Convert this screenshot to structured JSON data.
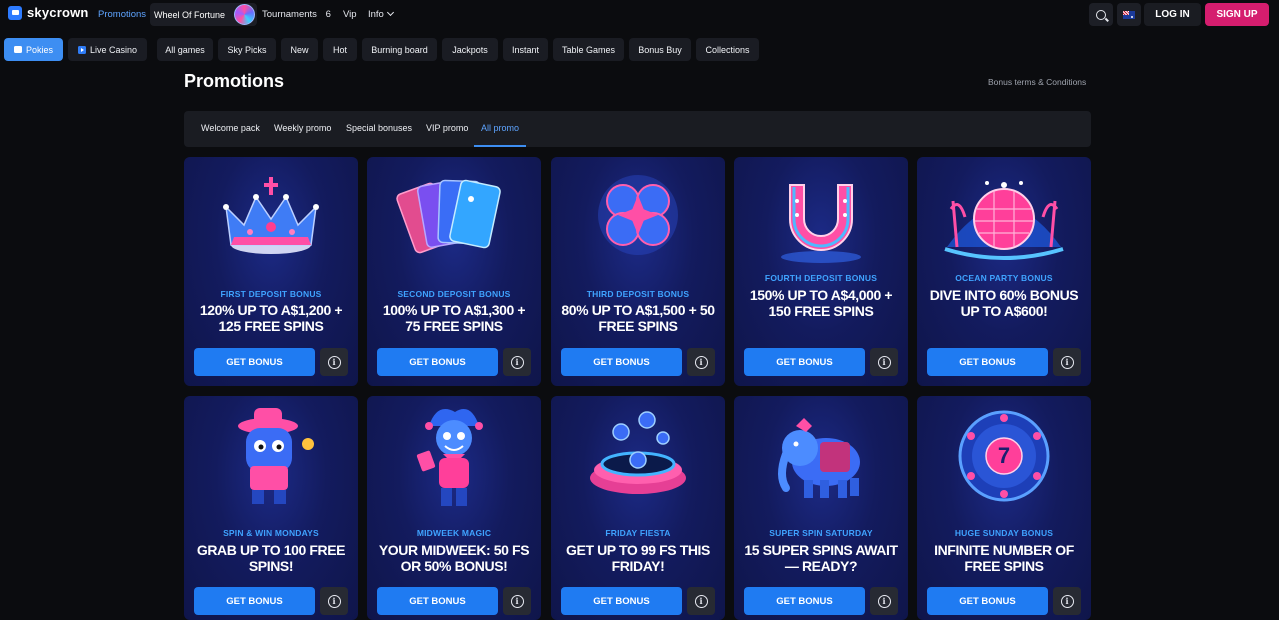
{
  "header": {
    "brand": "skycrown",
    "nav": {
      "promotions": "Promotions",
      "wheel_of_fortune": "Wheel Of Fortune",
      "tournaments": "Tournaments",
      "tournaments_count": "6",
      "vip": "Vip",
      "info": "Info"
    },
    "login_label": "LOG IN",
    "signup_label": "SIGN UP"
  },
  "categories": {
    "pokies": "Pokies",
    "live_casino": "Live Casino",
    "all_games": "All games",
    "sky_picks": "Sky Picks",
    "new": "New",
    "hot": "Hot",
    "burning_board": "Burning board",
    "jackpots": "Jackpots",
    "instant": "Instant",
    "table_games": "Table Games",
    "bonus_buy": "Bonus Buy",
    "collections": "Collections"
  },
  "page": {
    "title": "Promotions",
    "terms_link": "Bonus terms & Conditions"
  },
  "tabs": [
    "Welcome pack",
    "Weekly promo",
    "Special bonuses",
    "VIP promo",
    "All promo"
  ],
  "active_tab": "All promo",
  "cards": [
    {
      "subtitle": "FIRST DEPOSIT BONUS",
      "title": "120% UP TO A$1,200 + 125 FREE SPINS",
      "button": "GET BONUS",
      "art": "crown"
    },
    {
      "subtitle": "SECOND DEPOSIT BONUS",
      "title": "100% UP TO A$1,300 + 75 FREE SPINS",
      "button": "GET BONUS",
      "art": "cards"
    },
    {
      "subtitle": "THIRD DEPOSIT BONUS",
      "title": "80% UP TO A$1,500 + 50 FREE SPINS",
      "button": "GET BONUS",
      "art": "clover"
    },
    {
      "subtitle": "FOURTH DEPOSIT BONUS",
      "title": "150% UP TO A$4,000 + 150 FREE SPINS",
      "button": "GET BONUS",
      "art": "horseshoe"
    },
    {
      "subtitle": "OCEAN PARTY BONUS",
      "title": "DIVE INTO 60% BONUS UP TO A$600!",
      "button": "GET BONUS",
      "art": "disco-ball"
    },
    {
      "subtitle": "SPIN & WIN MONDAYS",
      "title": "GRAB UP TO 100 FREE SPINS!",
      "button": "GET BONUS",
      "art": "cowboy"
    },
    {
      "subtitle": "MIDWEEK MAGIC",
      "title": "YOUR MIDWEEK: 50 FS OR 50% BONUS!",
      "button": "GET BONUS",
      "art": "jester"
    },
    {
      "subtitle": "FRIDAY FIESTA",
      "title": "GET UP TO 99 FS THIS FRIDAY!",
      "button": "GET BONUS",
      "art": "coin-pot"
    },
    {
      "subtitle": "SUPER SPIN SATURDAY",
      "title": "15 SUPER SPINS AWAIT — READY?",
      "button": "GET BONUS",
      "art": "elephant"
    },
    {
      "subtitle": "HUGE SUNDAY BONUS",
      "title": "INFINITE NUMBER OF FREE SPINS",
      "button": "GET BONUS",
      "art": "lucky-seven-wheel"
    }
  ]
}
